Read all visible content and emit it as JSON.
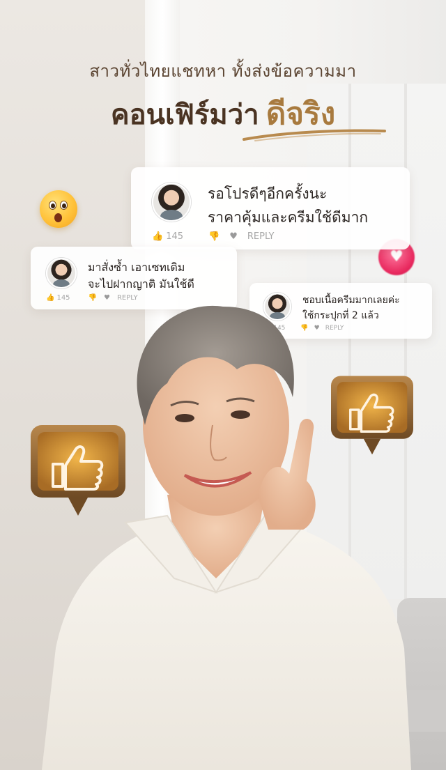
{
  "headline": {
    "subtitle": "สาวทั่วไทยแชทหา ทั้งส่งข้อความมา",
    "title": "คอนเฟิร์มว่า",
    "title_accent": "ดีจริง"
  },
  "comments": [
    {
      "text_line1": "รอโปรดีๆอีกครั้งนะ",
      "text_line2": "ราคาคุ้มและครีมใช้ดีมาก",
      "likes": "145",
      "reply": "REPLY"
    },
    {
      "text_line1": "มาสั่งซ้ำ เอาเซทเดิม",
      "text_line2": "จะไปฝากญาติ มันใช้ดี",
      "likes": "145",
      "reply": "REPLY"
    },
    {
      "text_line1": "ชอบเนื้อครีมมากเลยค่ะ",
      "text_line2": "ใช้กระปุกที่ 2 แล้ว",
      "likes": "145",
      "reply": "REPLY"
    }
  ],
  "icons": {
    "like": "thumbs-up-icon",
    "dislike": "thumbs-down-icon",
    "heart": "heart-icon",
    "wow_emoji": "wow-face-icon",
    "heart_emoji": "heart-emoji-icon",
    "like_bubble": "thumbs-up-bubble-icon"
  },
  "colors": {
    "accent_gold": "#a87a3e",
    "headline_brown": "#4a3322",
    "bubble_bronze": "#8a6234"
  }
}
